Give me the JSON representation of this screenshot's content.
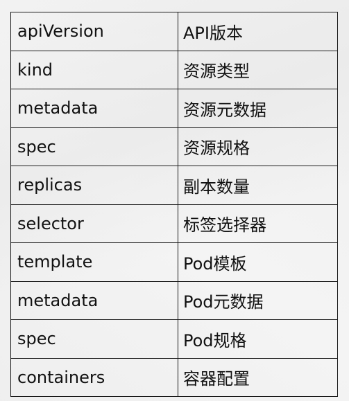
{
  "table": {
    "rows": [
      {
        "field": "apiVersion",
        "desc": "API版本"
      },
      {
        "field": "kind",
        "desc": "资源类型"
      },
      {
        "field": "metadata",
        "desc": "资源元数据"
      },
      {
        "field": "spec",
        "desc": "资源规格"
      },
      {
        "field": "replicas",
        "desc": "副本数量"
      },
      {
        "field": "selector",
        "desc": "标签选择器"
      },
      {
        "field": "template",
        "desc": "Pod模板"
      },
      {
        "field": "metadata",
        "desc": "Pod元数据"
      },
      {
        "field": "spec",
        "desc": "Pod规格"
      },
      {
        "field": "containers",
        "desc": "容器配置"
      }
    ]
  }
}
